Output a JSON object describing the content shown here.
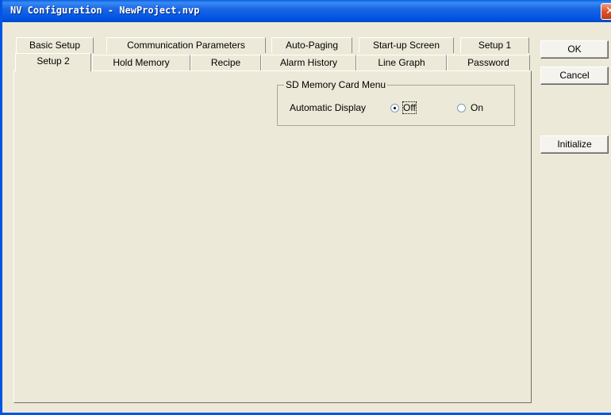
{
  "window": {
    "title": "NV Configuration - NewProject.nvp",
    "close_glyph": "✕"
  },
  "tabs": {
    "back_row": [
      "Basic Setup",
      "Communication Parameters",
      "Auto-Paging",
      "Start-up Screen",
      "Setup 1"
    ],
    "front_row": [
      "Setup 2",
      "Hold Memory",
      "Recipe",
      "Alarm History",
      "Line Graph",
      "Password"
    ],
    "active": "Setup 2"
  },
  "sd_card_group": {
    "legend": "SD Memory Card Menu",
    "field_label": "Automatic Display",
    "options": [
      {
        "label": "Off",
        "selected": true
      },
      {
        "label": "On",
        "selected": false
      }
    ]
  },
  "buttons": {
    "ok": "OK",
    "cancel": "Cancel",
    "initialize": "Initialize"
  }
}
